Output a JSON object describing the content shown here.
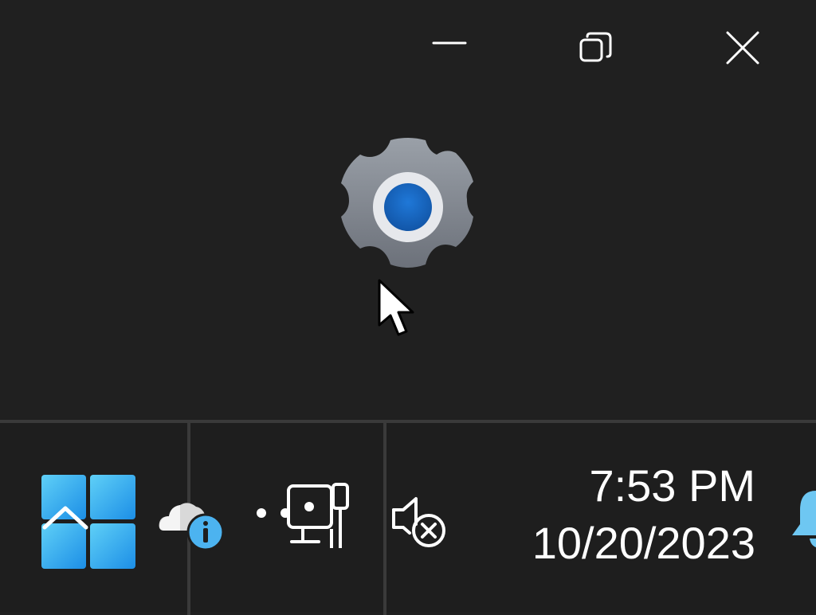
{
  "window": {
    "controls": {
      "minimize": "minimize",
      "restore": "restore",
      "close": "close"
    },
    "app_icon": "settings-gear-icon"
  },
  "taskbar": {
    "start_icon": "windows-start-icon",
    "tray_icons": [
      "weather-info-icon",
      "network-ethernet-icon",
      "volume-muted-icon",
      "notification-bell-icon"
    ],
    "clock": {
      "time": "7:53 PM",
      "date": "10/20/2023"
    }
  },
  "colors": {
    "background": "#202020",
    "taskbar": "#1e1e1e",
    "divider": "#3a3a3a",
    "accent_blue": "#1a6fd4",
    "gear_gray": "#8a8f98"
  }
}
